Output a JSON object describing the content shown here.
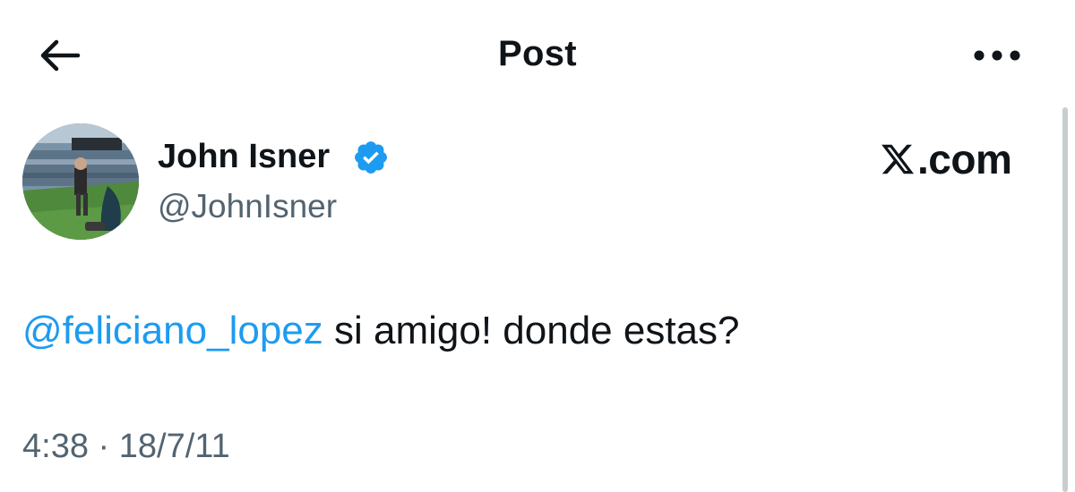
{
  "header": {
    "title": "Post",
    "back_icon": "arrow-left-icon",
    "more_icon": "more-horizontal-icon"
  },
  "brand": {
    "logo_icon": "x-logo-icon",
    "text": ".com"
  },
  "author": {
    "name": "John Isner",
    "handle": "@JohnIsner",
    "verified_icon": "verified-badge-icon",
    "verified_color": "#1d9bf0"
  },
  "tweet": {
    "mention": "@feliciano_lopez",
    "text": " si amigo! donde estas?"
  },
  "meta": {
    "time": "4:38",
    "separator": " · ",
    "date": "18/7/11"
  },
  "colors": {
    "text_primary": "#0f1419",
    "text_secondary": "#536471",
    "link": "#1d9bf0"
  }
}
